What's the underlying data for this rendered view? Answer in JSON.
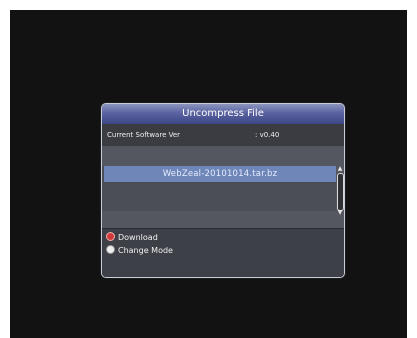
{
  "dialog": {
    "title": "Uncompress File",
    "info": {
      "label": "Current Software Ver",
      "value": ": v0.40"
    },
    "files": [
      "WebZeal-20101014.tar.bz"
    ],
    "legend": [
      {
        "color": "red",
        "label": "Download",
        "icon": "red-button-icon"
      },
      {
        "color": "white",
        "label": "Change Mode",
        "icon": "white-button-icon"
      }
    ],
    "scroll": {
      "up_icon": "▲",
      "down_icon": "▼"
    }
  },
  "colors": {
    "title_bar": "#5a63a0",
    "selected_row": "#6f86b8",
    "panel": "#3e4148"
  }
}
